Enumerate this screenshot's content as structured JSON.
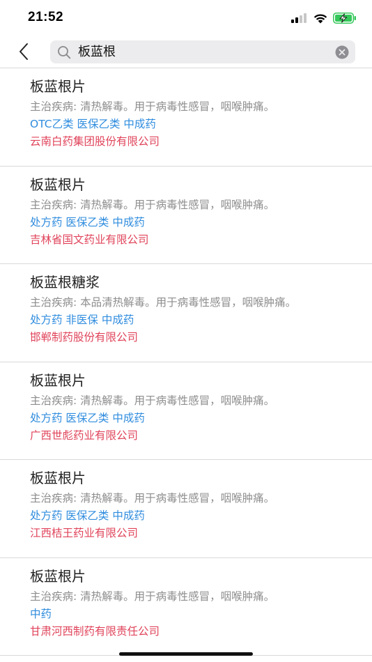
{
  "status_bar": {
    "time": "21:52",
    "icons": [
      "signal-icon",
      "wifi-icon",
      "battery-charging-icon"
    ]
  },
  "search": {
    "query": "板蓝根",
    "icon": "search-icon",
    "clear_icon": "clear-icon"
  },
  "nav": {
    "back_icon": "chevron-left-icon"
  },
  "colors": {
    "tags": "#2f8cde",
    "manufacturer": "#e0435a",
    "description": "#8e8e8e",
    "battery": "#34c759"
  },
  "results": [
    {
      "name": "板蓝根片",
      "desc": "主治疾病: 清热解毒。用于病毒性感冒，咽喉肿痛。",
      "tags": "OTC乙类  医保乙类  中成药",
      "maker": "云南白药集团股份有限公司"
    },
    {
      "name": "板蓝根片",
      "desc": "主治疾病: 清热解毒。用于病毒性感冒，咽喉肿痛。",
      "tags": "处方药  医保乙类  中成药",
      "maker": "吉林省国文药业有限公司"
    },
    {
      "name": "板蓝根糖浆",
      "desc": "主治疾病: 本品清热解毒。用于病毒性感冒，咽喉肿痛。",
      "tags": "处方药  非医保  中成药",
      "maker": "邯郸制药股份有限公司"
    },
    {
      "name": "板蓝根片",
      "desc": "主治疾病: 清热解毒。用于病毒性感冒，咽喉肿痛。",
      "tags": "处方药  医保乙类  中成药",
      "maker": "广西世彪药业有限公司"
    },
    {
      "name": "板蓝根片",
      "desc": "主治疾病: 清热解毒。用于病毒性感冒，咽喉肿痛。",
      "tags": "处方药  医保乙类  中成药",
      "maker": "江西桔王药业有限公司"
    },
    {
      "name": "板蓝根片",
      "desc": "主治疾病: 清热解毒。用于病毒性感冒，咽喉肿痛。",
      "tags": "中药",
      "maker": "甘肃河西制药有限责任公司"
    }
  ]
}
